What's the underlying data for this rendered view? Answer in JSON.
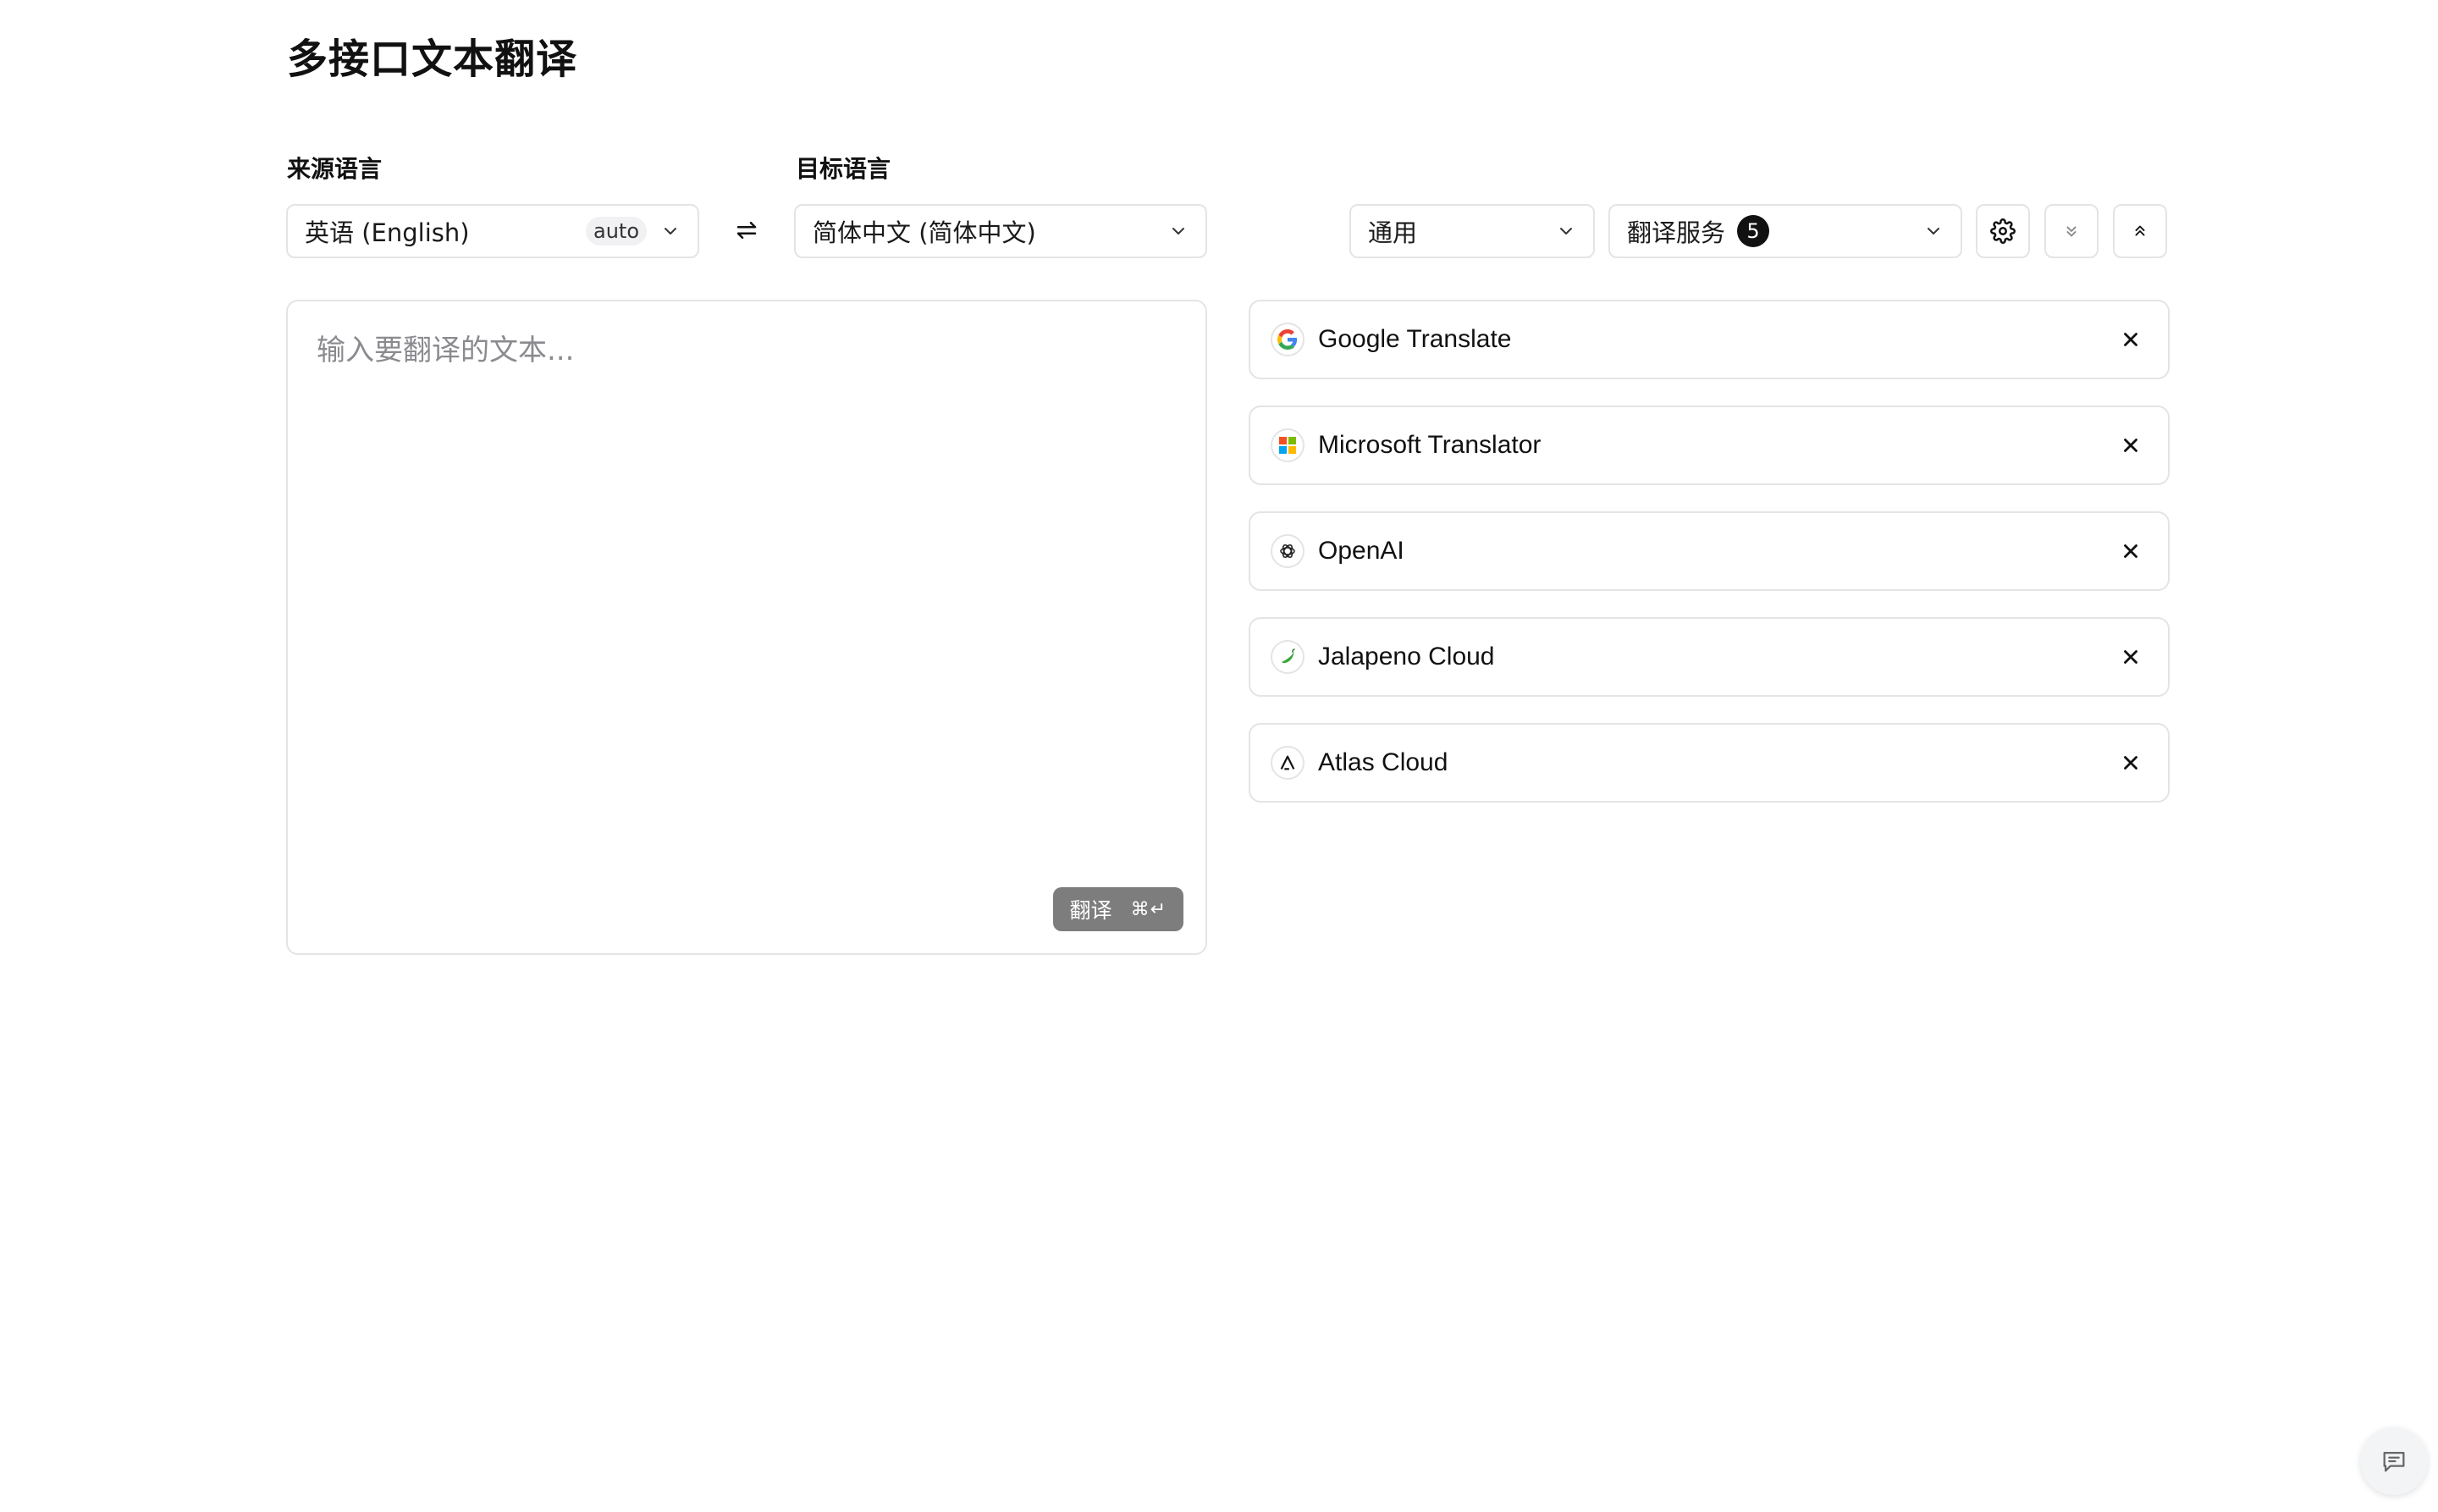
{
  "page": {
    "title": "多接口文本翻译"
  },
  "source": {
    "label": "来源语言",
    "value": "英语 (English)",
    "badge": "auto"
  },
  "target": {
    "label": "目标语言",
    "value": "简体中文 (简体中文)"
  },
  "domain_select": {
    "value": "通用"
  },
  "services_select": {
    "label": "翻译服务",
    "count": "5"
  },
  "input": {
    "placeholder": "输入要翻译的文本...",
    "translate_label": "翻译",
    "shortcut": "⌘↵"
  },
  "services": [
    {
      "name": "Google Translate",
      "icon": "google-logo-icon"
    },
    {
      "name": "Microsoft Translator",
      "icon": "microsoft-logo-icon"
    },
    {
      "name": "OpenAI",
      "icon": "openai-logo-icon"
    },
    {
      "name": "Jalapeno Cloud",
      "icon": "jalapeno-logo-icon"
    },
    {
      "name": "Atlas Cloud",
      "icon": "atlas-logo-icon"
    }
  ],
  "colors": {
    "border": "#e4e4e7",
    "text": "#111111",
    "translate_button": "#7d7d7d",
    "badge_dark": "#111111"
  }
}
